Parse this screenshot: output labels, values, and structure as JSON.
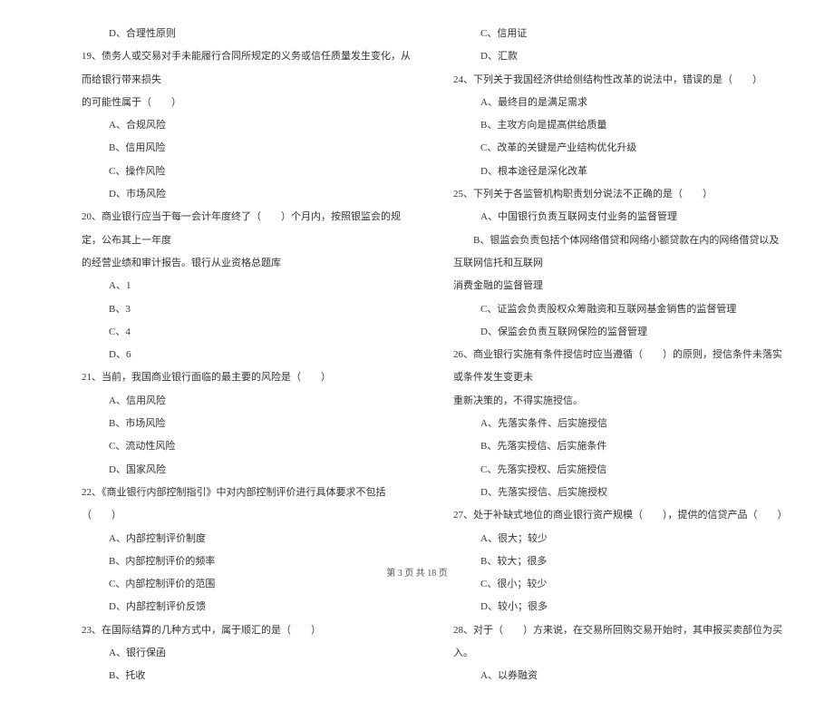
{
  "left_column": {
    "items": [
      {
        "type": "option",
        "text": "D、合理性原则"
      },
      {
        "type": "question",
        "text": "19、债务人或交易对手未能履行合同所规定的义务或信任质量发生变化，从而给银行带来损失"
      },
      {
        "type": "question",
        "text": "的可能性属于（　　）"
      },
      {
        "type": "option",
        "text": "A、合规风险"
      },
      {
        "type": "option",
        "text": "B、信用风险"
      },
      {
        "type": "option",
        "text": "C、操作风险"
      },
      {
        "type": "option",
        "text": "D、市场风险"
      },
      {
        "type": "question",
        "text": "20、商业银行应当于每一会计年度终了（　　）个月内，按照银监会的规定，公布其上一年度"
      },
      {
        "type": "question",
        "text": "的经营业绩和审计报告。银行从业资格总题库"
      },
      {
        "type": "option",
        "text": "A、1"
      },
      {
        "type": "option",
        "text": "B、3"
      },
      {
        "type": "option",
        "text": "C、4"
      },
      {
        "type": "option",
        "text": "D、6"
      },
      {
        "type": "question",
        "text": "21、当前，我国商业银行面临的最主要的风险是（　　）"
      },
      {
        "type": "option",
        "text": "A、信用风险"
      },
      {
        "type": "option",
        "text": "B、市场风险"
      },
      {
        "type": "option",
        "text": "C、流动性风险"
      },
      {
        "type": "option",
        "text": "D、国家风险"
      },
      {
        "type": "question",
        "text": "22、《商业银行内部控制指引》中对内部控制评价进行具体要求不包括（　　）"
      },
      {
        "type": "option",
        "text": "A、内部控制评价制度"
      },
      {
        "type": "option",
        "text": "B、内部控制评价的频率"
      },
      {
        "type": "option",
        "text": "C、内部控制评价的范围"
      },
      {
        "type": "option",
        "text": "D、内部控制评价反馈"
      },
      {
        "type": "question",
        "text": "23、在国际结算的几种方式中，属于顺汇的是（　　）"
      },
      {
        "type": "option",
        "text": "A、银行保函"
      },
      {
        "type": "option",
        "text": "B、托收"
      }
    ]
  },
  "right_column": {
    "items": [
      {
        "type": "option",
        "text": "C、信用证"
      },
      {
        "type": "option",
        "text": "D、汇款"
      },
      {
        "type": "question",
        "text": "24、下列关于我国经济供给侧结构性改革的说法中，错误的是（　　）"
      },
      {
        "type": "option",
        "text": "A、最终目的是满足需求"
      },
      {
        "type": "option",
        "text": "B、主攻方向是提高供给质量"
      },
      {
        "type": "option",
        "text": "C、改革的关键是产业结构优化升级"
      },
      {
        "type": "option",
        "text": "D、根本途径是深化改革"
      },
      {
        "type": "question",
        "text": "25、下列关于各监管机构职责划分说法不正确的是（　　）"
      },
      {
        "type": "option",
        "text": "A、中国银行负责互联网支付业务的监督管理"
      },
      {
        "type": "question",
        "text": "　　B、银监会负责包括个体网络借贷和网络小额贷款在内的网络借贷以及互联网信托和互联网"
      },
      {
        "type": "question",
        "text": "消费金融的监督管理"
      },
      {
        "type": "option",
        "text": "C、证监会负责股权众筹融资和互联网基金销售的监督管理"
      },
      {
        "type": "option",
        "text": "D、保监会负责互联网保险的监督管理"
      },
      {
        "type": "question",
        "text": "26、商业银行实施有条件授信时应当遵循（　　）的原则，授信条件未落实或条件发生变更未"
      },
      {
        "type": "question",
        "text": "重新决策的，不得实施授信。"
      },
      {
        "type": "option",
        "text": "A、先落实条件、后实施授信"
      },
      {
        "type": "option",
        "text": "B、先落实授信、后实施条件"
      },
      {
        "type": "option",
        "text": "C、先落实授权、后实施授信"
      },
      {
        "type": "option",
        "text": "D、先落实授信、后实施授权"
      },
      {
        "type": "question",
        "text": "27、处于补缺式地位的商业银行资产规模（　　），提供的信贷产品（　　）"
      },
      {
        "type": "option",
        "text": "A、很大；较少"
      },
      {
        "type": "option",
        "text": "B、较大；很多"
      },
      {
        "type": "option",
        "text": "C、很小；较少"
      },
      {
        "type": "option",
        "text": "D、较小；很多"
      },
      {
        "type": "question",
        "text": "28、对于（　　）方来说，在交易所回购交易开始时，其申报买卖部位为买入。"
      },
      {
        "type": "option",
        "text": "A、以券融资"
      }
    ]
  },
  "footer": {
    "text": "第 3 页 共 18 页"
  }
}
